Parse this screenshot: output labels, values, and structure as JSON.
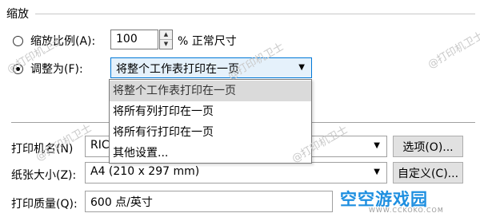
{
  "section": {
    "title": "缩放"
  },
  "scale": {
    "adjust_label": "缩放比例(A):",
    "value": "100",
    "unit": "% 正常尺寸",
    "fit_label": "调整为(F):",
    "fit_selected": "将整个工作表打印在一页"
  },
  "dropdown": {
    "options": [
      "将整个工作表打印在一页",
      "将所有列打印在一页",
      "将所有行打印在一页",
      "其他设置..."
    ]
  },
  "printer": {
    "name_label": "打印机名(N)",
    "name_value": "RIC",
    "options_button": "选项(O)...",
    "paper_label": "纸张大小(Z):",
    "paper_value": "A4 (210 x 297 mm)",
    "custom_button": "自定义(C)...",
    "quality_label": "打印质量(Q):",
    "quality_value": "600 点/英寸"
  },
  "watermark": {
    "text": "@打印机卫士"
  },
  "brand": {
    "name": "空空游戏园",
    "url": "WWW.CCKOKO.COM"
  }
}
